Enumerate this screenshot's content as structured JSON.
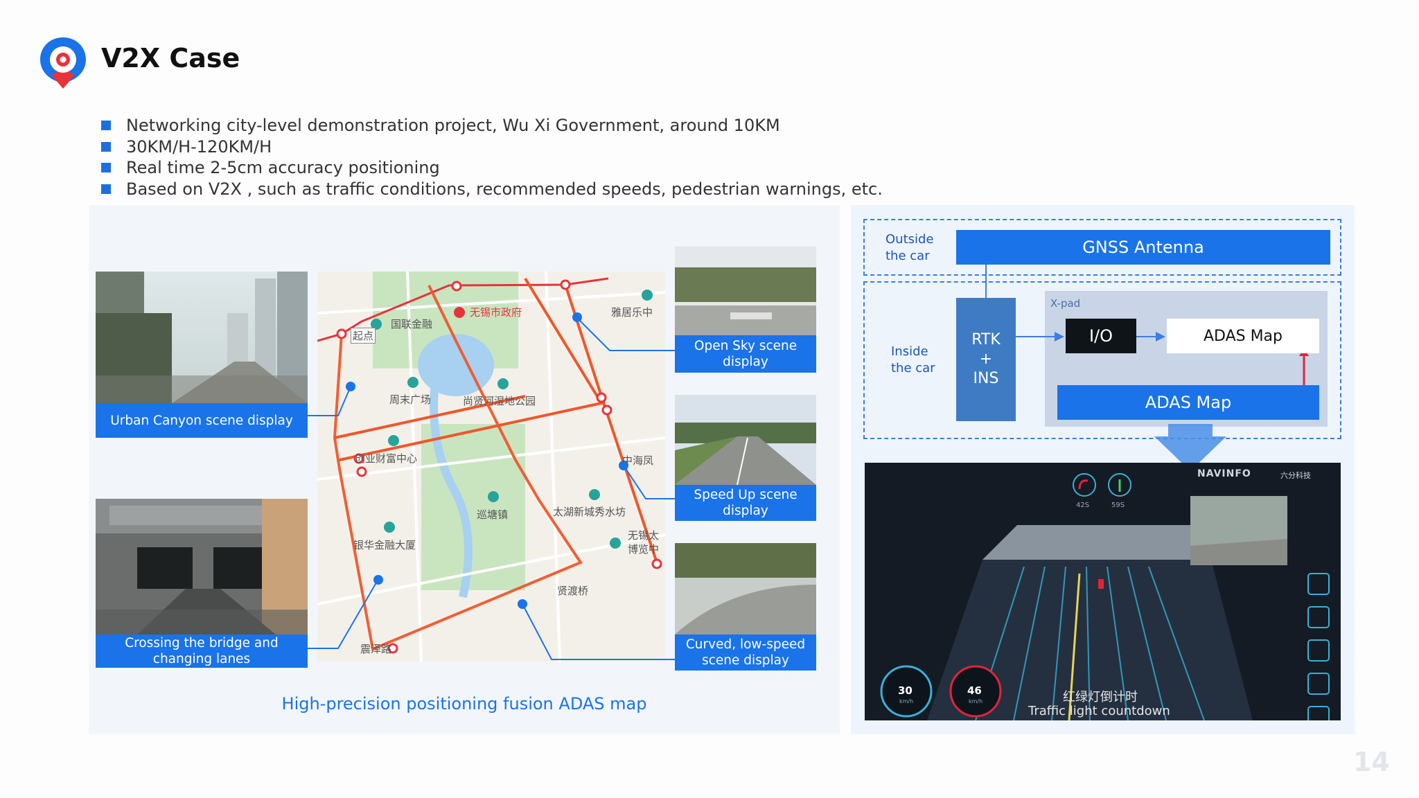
{
  "header": {
    "title": "V2X Case"
  },
  "bullets": [
    "Networking city-level demonstration project, Wu Xi Government, around 10KM",
    "30KM/H-120KM/H",
    "Real time 2-5cm accuracy positioning",
    "Based on V2X , such as traffic conditions, recommended speeds, pedestrian warnings, etc."
  ],
  "left_panel": {
    "captions": {
      "urban": "Urban Canyon scene display",
      "bridge": "Crossing the bridge and changing lanes",
      "opensky": "Open Sky scene display",
      "speedup": "Speed Up scene display",
      "curved": "Curved, low-speed scene display"
    },
    "map_labels": {
      "l1": "无锡市政府",
      "l2": "雅居乐中",
      "l3": "国联金融",
      "l4": "起点",
      "l5": "周末广场",
      "l6": "尚贤河湿地公园",
      "l7": "创业财富中心",
      "l8": "中海凤",
      "l9": "巡塘镇",
      "l10": "太湖新城秀水坊",
      "l11": "银华金融大厦",
      "l12": "无锡太",
      "l13": "博览中",
      "l14": "贤渡桥",
      "l15": "震泽路"
    },
    "bottom_caption": "High-precision positioning fusion ADAS map"
  },
  "right_panel": {
    "outside_label": "Outside the car",
    "inside_label": "Inside the car",
    "gnss": "GNSS Antenna",
    "xpad": "X-pad",
    "rtk": "RTK",
    "plus": "+",
    "ins": "INS",
    "io": "I/O",
    "adas_map_small": "ADAS  Map",
    "adas_map_big": "ADAS  Map",
    "screen": {
      "brand": "NAVINFO",
      "brand2": "六分科技",
      "timer1": "42S",
      "timer2": "59S",
      "speed1": "30",
      "speed2": "46",
      "unit": "km/h",
      "cn_caption": "红绿灯倒计时",
      "en_caption": "Traffic light countdown"
    }
  },
  "page_number": "14",
  "colors": {
    "accent": "#1a73e8",
    "route": "#f0562a",
    "logo_red": "#e8333a"
  }
}
